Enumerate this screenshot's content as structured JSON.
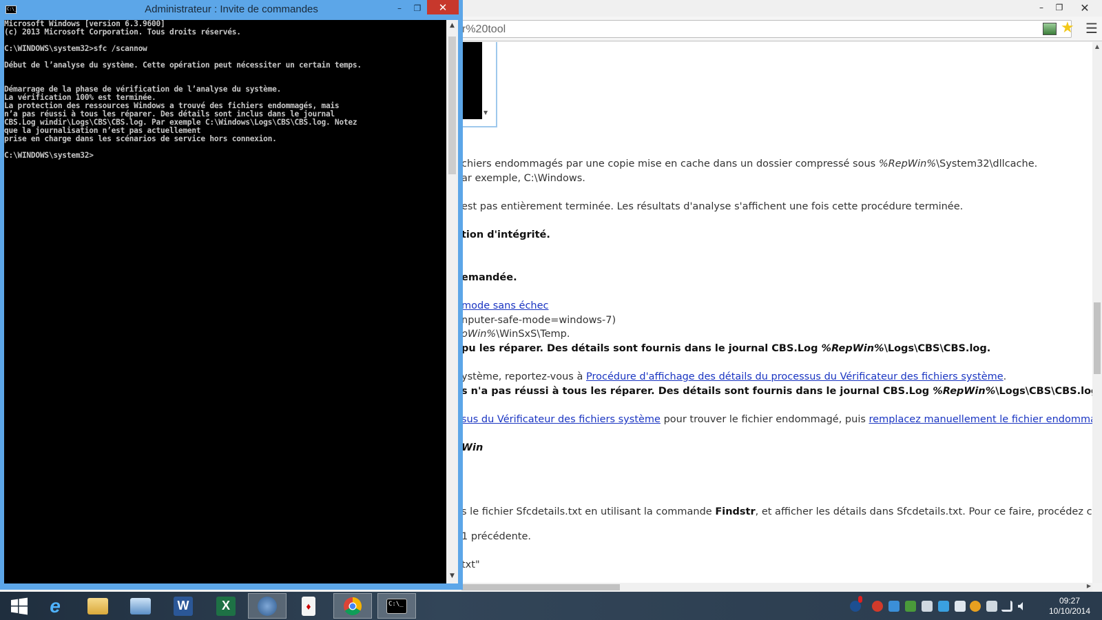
{
  "cmd": {
    "title": "Administrateur : Invite de commandes",
    "icon_label": "C:\\_",
    "min": "–",
    "max": "❐",
    "close": "✕",
    "output_lines": [
      "Microsoft Windows [version 6.3.9600]",
      "(c) 2013 Microsoft Corporation. Tous droits réservés.",
      "",
      "C:\\WINDOWS\\system32>sfc /scannow",
      "",
      "Début de l’analyse du système. Cette opération peut nécessiter un certain temps.",
      "",
      "",
      "Démarrage de la phase de vérification de l’analyse du système.",
      "La vérification 100% est terminée.",
      "La protection des ressources Windows a trouvé des fichiers endommagés, mais",
      "n’a pas réussi à tous les réparer. Des détails sont inclus dans le journal",
      "CBS.Log windir\\Logs\\CBS\\CBS.log. Par exemple C:\\Windows\\Logs\\CBS\\CBS.log. Notez",
      "que la journalisation n’est pas actuellement",
      "prise en charge dans les scénarios de service hors connexion.",
      "",
      "C:\\WINDOWS\\system32>"
    ]
  },
  "browser": {
    "min": "–",
    "max": "❐",
    "close": "✕",
    "address": "r%20tool",
    "page": {
      "line1_a": "chiers endommagés par une copie mise en cache dans un dossier compressé sous ",
      "line1_b": "%RepWin%",
      "line1_c": "\\System32\\dllcache.",
      "line2": "ar exemple, C:\\Windows.",
      "line3": "est pas entièrement terminée. Les résultats d'analyse s'affichent une fois cette procédure terminée.",
      "line4": "tion d'intégrité.",
      "line5": "emandée.",
      "line6_link": "mode sans échec",
      "line7": "nputer-safe-mode=windows-7)",
      "line8_a": "oWin%",
      "line8_b": "\\WinSxS\\Temp.",
      "line9_a": "pu les réparer. Des détails sont fournis dans le journal CBS.Log ",
      "line9_b": "%RepWin%",
      "line9_c": "\\Logs\\CBS\\CBS.log.",
      "line10_a": "ystème, reportez-vous à ",
      "line10_link": "Procédure d'affichage des détails du processus du Vérificateur des fichiers système",
      "line10_b": ".",
      "line11_a": "s n'a pas réussi à tous les réparer. Des détails sont fournis dans le journal CBS.Log ",
      "line11_b": "%RepWin%",
      "line11_c": "\\Logs\\CBS\\CBS.log.",
      "line12_link1": "sus du Vérificateur des fichiers système",
      "line12_b": " pour trouver le fichier endommagé, puis ",
      "line12_link2": "remplacez manuellement le fichier endommagé p",
      "line13": "Win",
      "line14_a": "s le fichier Sfcdetails.txt en utilisant la commande ",
      "line14_b": "Findstr",
      "line14_c": ", et afficher les détails dans Sfcdetails.txt. Pour ce faire, procédez comme",
      "line15": " 1 précédente.",
      "line16": "txt\""
    }
  },
  "taskbar": {
    "apps": [
      {
        "name": "start-button",
        "icon": "windows-logo-icon"
      },
      {
        "name": "internet-explorer",
        "icon": "ie-icon",
        "glyph": "e"
      },
      {
        "name": "file-explorer",
        "icon": "folder-icon"
      },
      {
        "name": "remote-desktop",
        "icon": "computer-icon"
      },
      {
        "name": "word",
        "icon": "word-icon",
        "glyph": "W"
      },
      {
        "name": "excel",
        "icon": "excel-icon",
        "glyph": "X"
      },
      {
        "name": "thunderbird",
        "icon": "thunderbird-icon"
      },
      {
        "name": "solitaire",
        "icon": "cards-icon"
      },
      {
        "name": "chrome",
        "icon": "chrome-icon"
      },
      {
        "name": "command-prompt",
        "icon": "cmd-icon",
        "glyph": "C:\\_"
      }
    ],
    "clock_time": "09:27",
    "clock_date": "10/10/2014"
  }
}
